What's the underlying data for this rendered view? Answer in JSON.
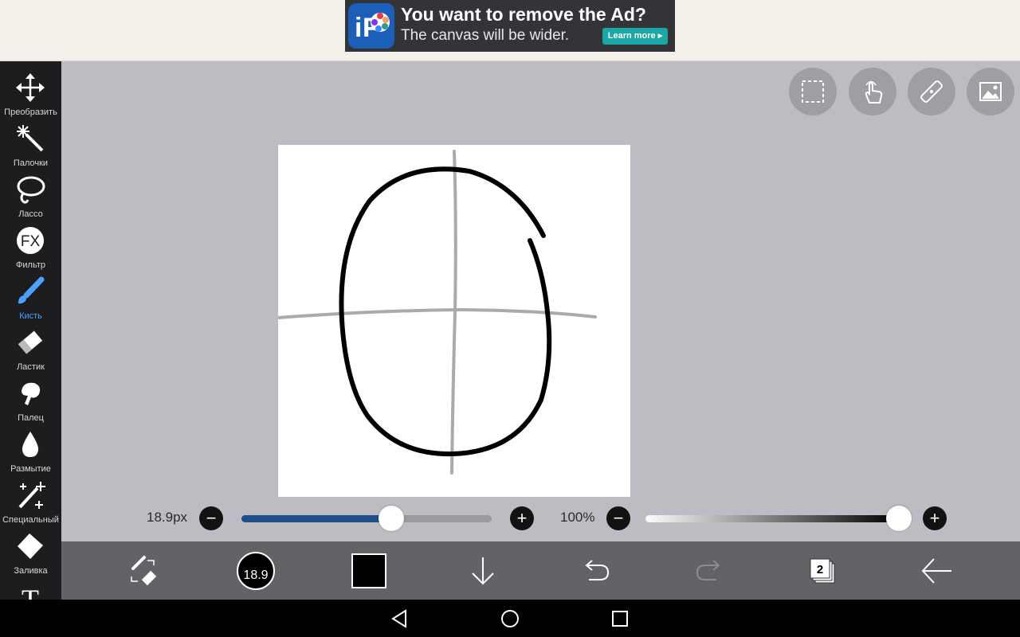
{
  "ad": {
    "title": "You want to remove the Ad?",
    "subtitle": "The canvas will be wider.",
    "button": "Learn more ▸"
  },
  "toolbar": {
    "items": [
      {
        "label": "Преобразить",
        "icon": "move-icon"
      },
      {
        "label": "Палочки",
        "icon": "magic-wand-icon"
      },
      {
        "label": "Лассо",
        "icon": "lasso-icon"
      },
      {
        "label": "Фильтр",
        "icon": "fx-filter-icon"
      },
      {
        "label": "Кисть",
        "icon": "brush-icon",
        "active": true
      },
      {
        "label": "Ластик",
        "icon": "eraser-icon"
      },
      {
        "label": "Палец",
        "icon": "smudge-finger-icon"
      },
      {
        "label": "Размытие",
        "icon": "blur-drop-icon"
      },
      {
        "label": "Специальный",
        "icon": "special-effects-icon"
      },
      {
        "label": "Заливка",
        "icon": "fill-bucket-icon"
      },
      {
        "label": "",
        "icon": "text-tool-icon"
      }
    ],
    "fx_text": "FX",
    "text_tool_glyph": "T"
  },
  "top_tools": [
    "selection-icon",
    "touch-gesture-icon",
    "ruler-icon",
    "reference-image-icon"
  ],
  "brush_size": {
    "label": "18.9px",
    "fraction": 0.6,
    "minus": "−",
    "plus": "+"
  },
  "opacity": {
    "label": "100%",
    "fraction": 1.0,
    "minus": "−",
    "plus": "+"
  },
  "bottombar": {
    "brush_size_badge": "18.9",
    "current_color": "#000000",
    "layer_count": "2"
  },
  "colors": {
    "brush_active": "#4aa1ff",
    "slider_fill": "#1e4d8a",
    "workarea": "#bdbcc2"
  }
}
